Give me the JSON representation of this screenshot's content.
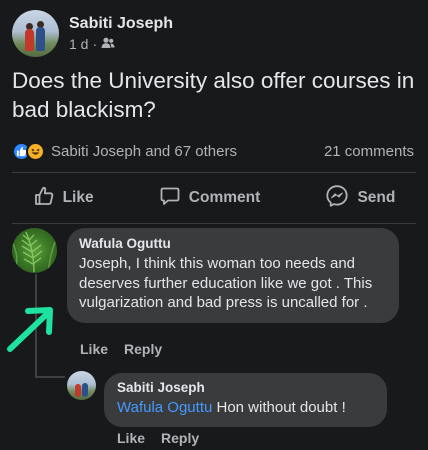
{
  "post": {
    "author": "Sabiti Joseph",
    "time": "1 d",
    "separator": "·",
    "audience_icon": "friends-icon",
    "text": "Does the University also offer courses in bad blackism?",
    "reactions_summary": "Sabiti Joseph and 67 others",
    "comments_count": "21 comments",
    "reaction_icons": [
      "like-reaction-icon",
      "haha-reaction-icon"
    ]
  },
  "actions": {
    "like": "Like",
    "comment": "Comment",
    "send": "Send"
  },
  "comments": [
    {
      "author": "Wafula Oguttu",
      "text": "Joseph, I think this woman too needs and deserves further education like we got . This vulgarization  and  bad press is uncalled for .",
      "like_label": "Like",
      "reply_label": "Reply"
    }
  ],
  "reply": {
    "author": "Sabiti Joseph",
    "mention": "Wafula Oguttu",
    "text": " Hon without doubt !",
    "like_label": "Like",
    "reply_label": "Reply"
  },
  "colors": {
    "background": "#18191a",
    "bubble": "#3a3b3c",
    "link": "#4599ff",
    "arrow": "#1ee3a0"
  }
}
